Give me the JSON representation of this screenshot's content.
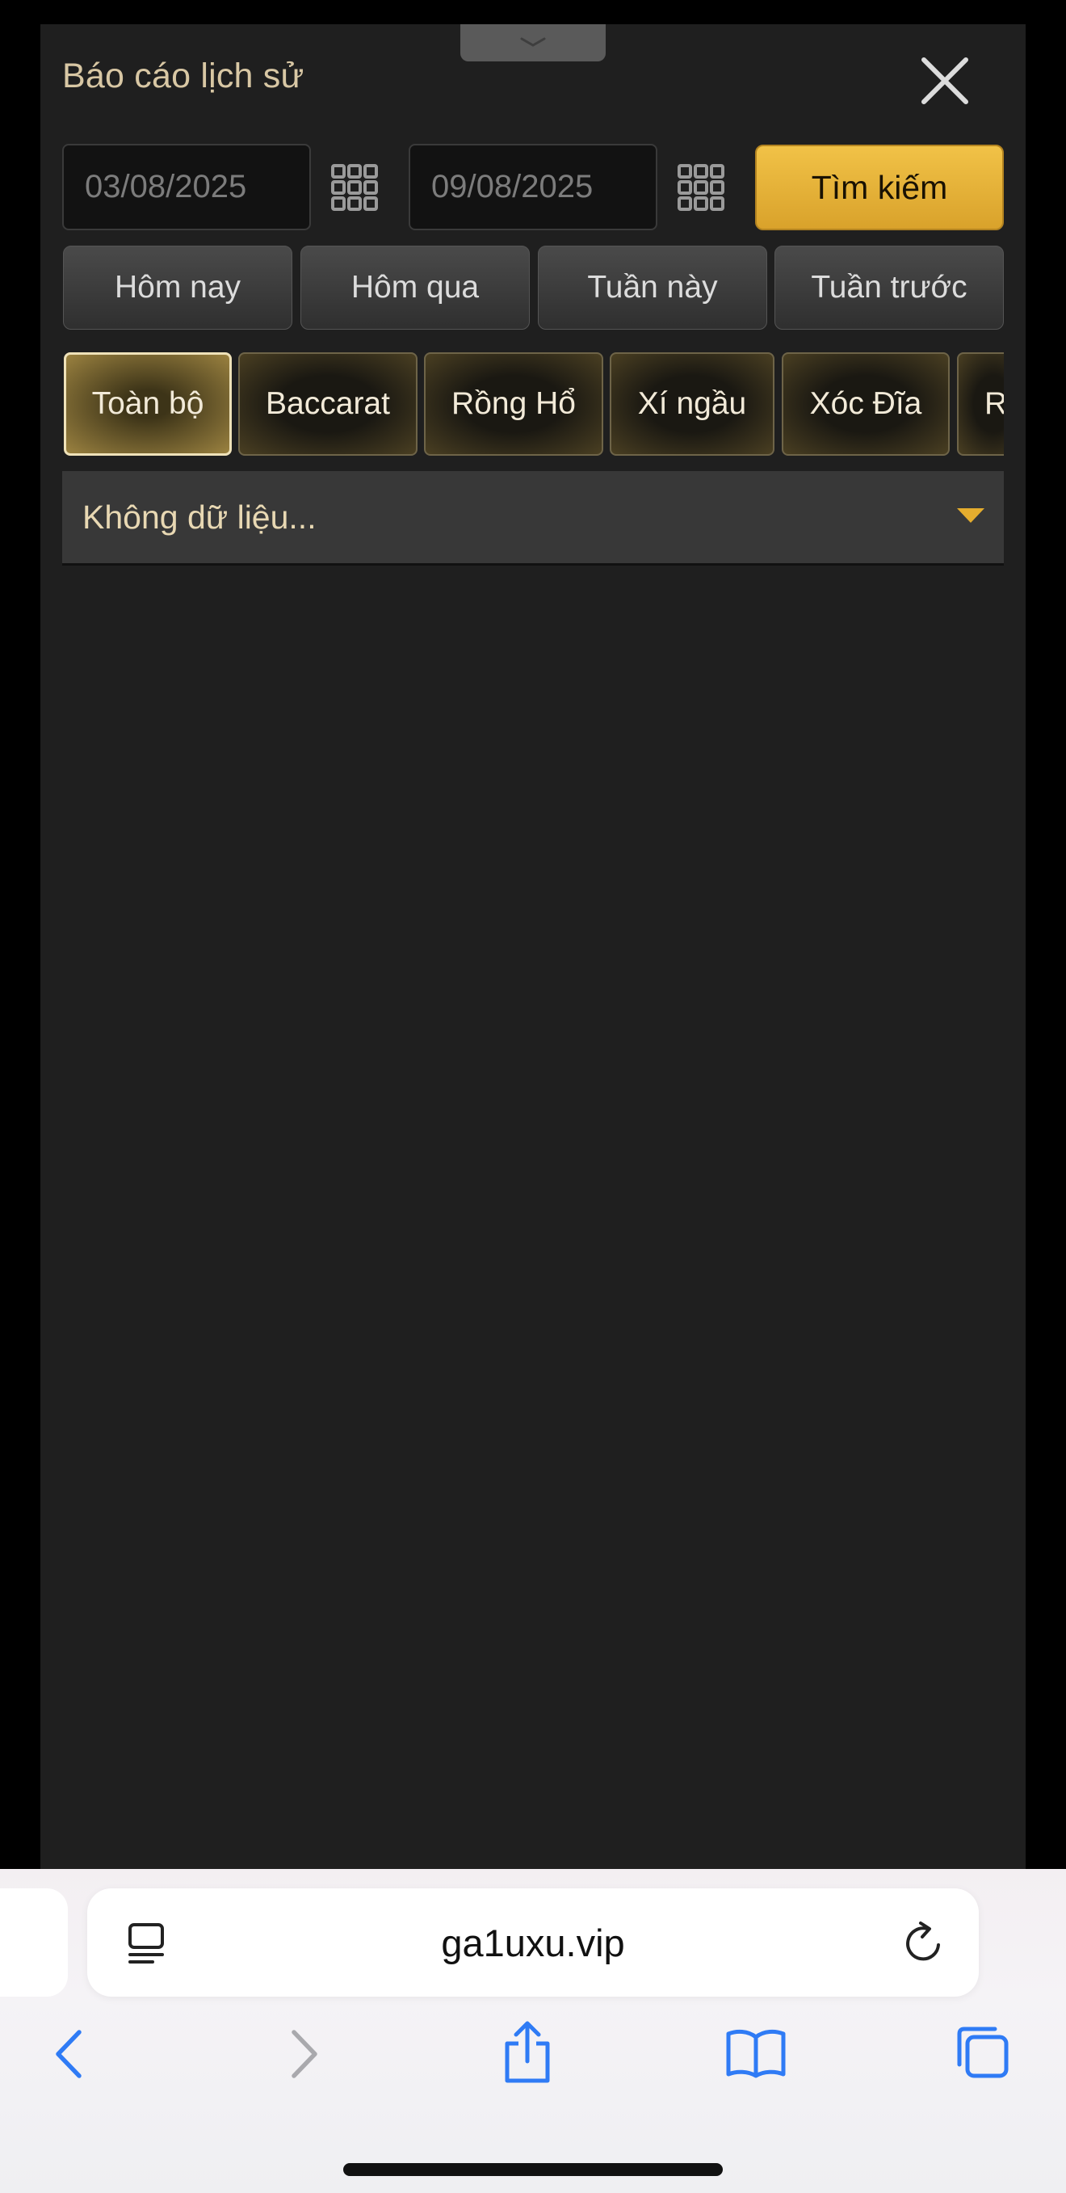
{
  "dialog": {
    "title": "Báo cáo lịch sử",
    "close_label": "Close"
  },
  "filters": {
    "start_date": "03/08/2025",
    "end_date": "09/08/2025",
    "search_label": "Tìm kiếm",
    "quick_ranges": [
      "Hôm nay",
      "Hôm qua",
      "Tuần này",
      "Tuần trước"
    ]
  },
  "game_tabs": {
    "active_index": 0,
    "items": [
      "Toàn bộ",
      "Baccarat",
      "Rồng Hổ",
      "Xí ngầu",
      "Xóc Đĩa",
      "R"
    ]
  },
  "result": {
    "empty_text": "Không dữ liệu..."
  },
  "browser": {
    "url": "ga1uxu.vip"
  },
  "colors": {
    "accent_gold": "#f1c247",
    "panel_bg": "#1f1f1f",
    "title_text": "#d8c7a4",
    "ios_blue": "#2f7bf5"
  }
}
